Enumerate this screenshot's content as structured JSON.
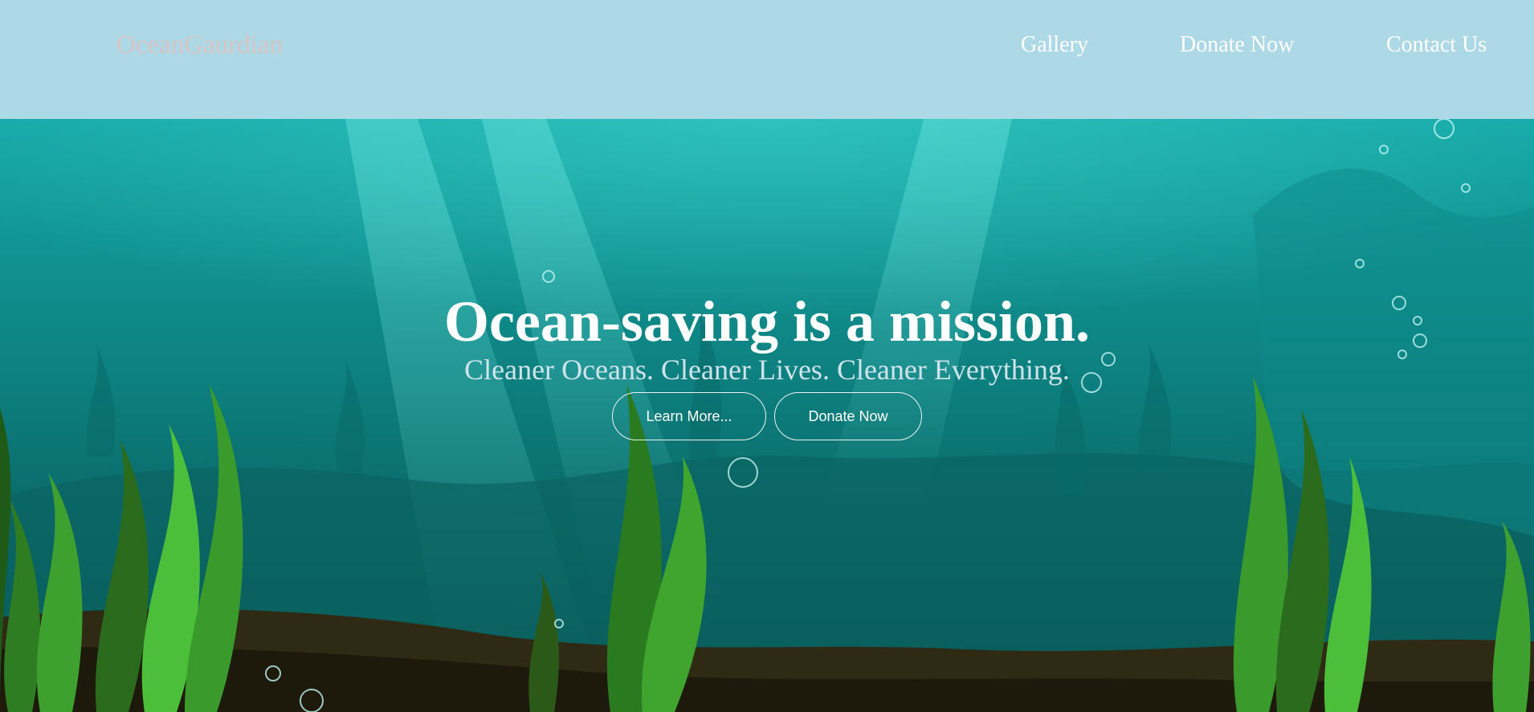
{
  "navbar": {
    "brand": "OceanGaurdian",
    "links": [
      {
        "label": "Gallery"
      },
      {
        "label": "Donate Now"
      },
      {
        "label": "Contact Us"
      }
    ]
  },
  "hero": {
    "title": "Ocean-saving is a mission.",
    "subtitle": "Cleaner Oceans. Cleaner Lives. Cleaner Everything.",
    "buttons": [
      {
        "label": "Learn More..."
      },
      {
        "label": "Donate Now"
      }
    ]
  },
  "colors": {
    "navbar_bg": "#add8e6",
    "brand_text": "#d8c4c4",
    "ocean_light": "#1ba9a8",
    "ocean_dark": "#07504f",
    "seaweed": "#2e8b2e"
  }
}
